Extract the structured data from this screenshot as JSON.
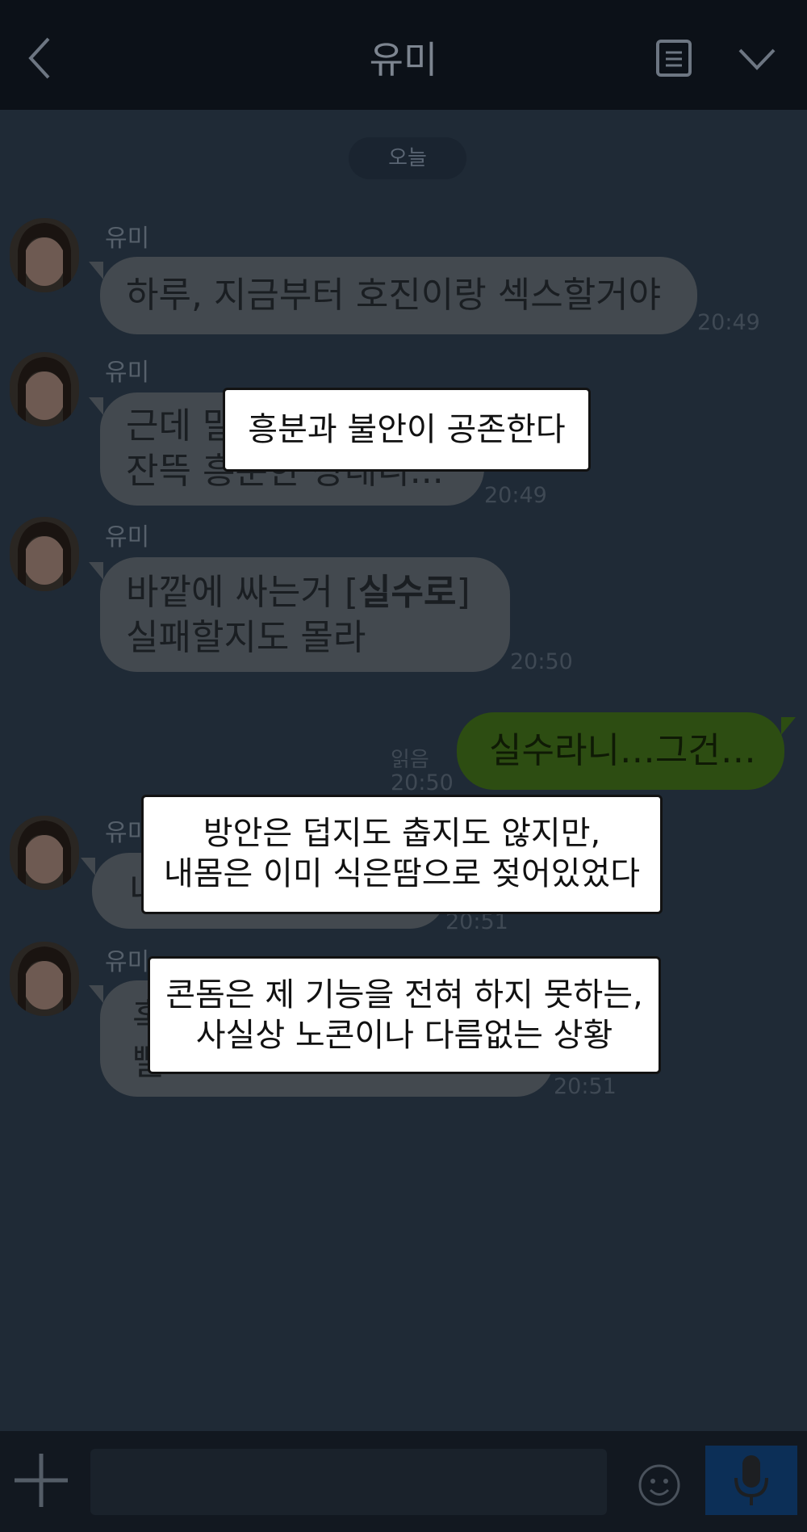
{
  "header": {
    "title": "유미",
    "back_icon": "chevron-left-icon",
    "menu_icon": "document-list-icon",
    "collapse_icon": "chevron-down-icon"
  },
  "chat": {
    "date_divider": "오늘",
    "messages": [
      {
        "sender": "유미",
        "lines": [
          "하루, 지금부터 호진이랑 섹스할거야"
        ],
        "time": "20:49"
      },
      {
        "sender": "유미",
        "lines": [
          "근데 말",
          "잔뜩 흥분한 상태니..."
        ],
        "time": "20:49"
      },
      {
        "sender": "유미",
        "line1_pre": "바깥에 싸는거 [",
        "line1_bold": "실수로",
        "line1_post": "]",
        "line2": "실패할지도 몰라",
        "time": "20:50"
      },
      {
        "mine": true,
        "text": "실수라니…그건…",
        "read": "읽음",
        "time": "20:50"
      },
      {
        "sender": "유미",
        "lines": [
          "내"
        ],
        "time": "20:51"
      },
      {
        "sender": "유미",
        "lines": [
          "혹",
          "빨"
        ],
        "time": "20:51"
      }
    ]
  },
  "overlays": [
    {
      "lines": [
        "흥분과 불안이 공존한다"
      ]
    },
    {
      "lines": [
        "방안은 덥지도 춥지도 않지만,",
        "내몸은 이미 식은땀으로 젖어있었다"
      ]
    },
    {
      "lines": [
        "콘돔은 제 기능을 전혀 하지 못하는,",
        "사실상 노콘이나 다름없는 상황"
      ]
    }
  ],
  "input_bar": {
    "plus_icon": "plus-icon",
    "placeholder": "",
    "emoji_icon": "emoji-icon",
    "mic_icon": "microphone-icon"
  },
  "colors": {
    "chat_background": "#1f2a36",
    "header_background": "#0c1118",
    "incoming_bubble": "#43494f",
    "outgoing_bubble": "#2d4d12",
    "mic_button": "#0c2f57"
  }
}
